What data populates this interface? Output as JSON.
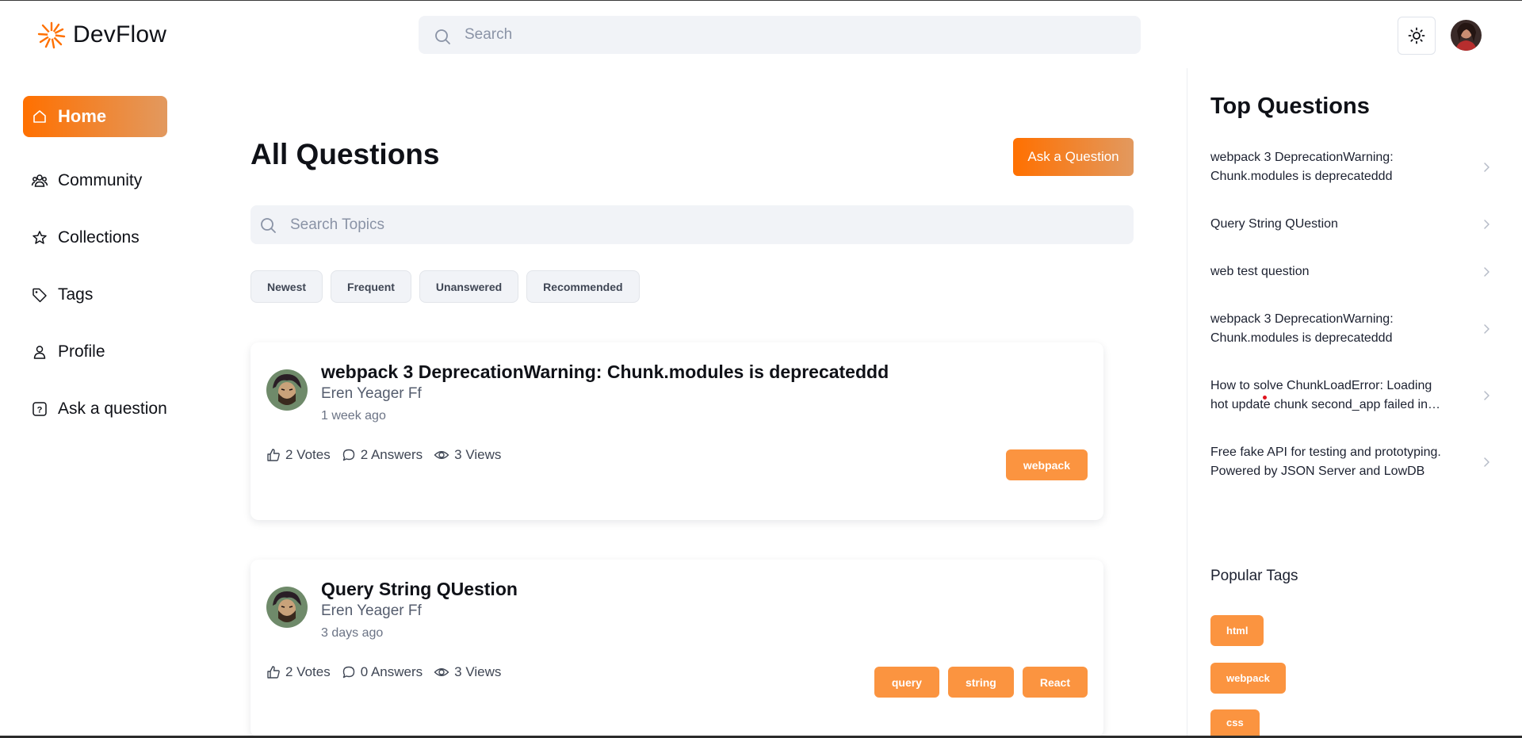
{
  "brand": {
    "name": "DevFlow"
  },
  "header": {
    "search_placeholder": "Search"
  },
  "sidebar": {
    "items": [
      {
        "label": "Home",
        "icon": "home-icon",
        "active": true
      },
      {
        "label": "Community",
        "icon": "users-icon",
        "active": false
      },
      {
        "label": "Collections",
        "icon": "star-icon",
        "active": false
      },
      {
        "label": "Tags",
        "icon": "tag-icon",
        "active": false
      },
      {
        "label": "Profile",
        "icon": "user-icon",
        "active": false
      },
      {
        "label": "Ask a question",
        "icon": "question-icon",
        "active": false
      }
    ]
  },
  "main": {
    "title": "All Questions",
    "ask_label": "Ask a Question",
    "search_placeholder": "Search Topics",
    "filters": [
      "Newest",
      "Frequent",
      "Unanswered",
      "Recommended"
    ],
    "questions": [
      {
        "title": "webpack 3 DeprecationWarning: Chunk.modules is deprecateddd",
        "author": "Eren Yeager Ff",
        "time": "1 week ago",
        "votes": "2 Votes",
        "answers": "2 Answers",
        "views": "3 Views",
        "tags": [
          "webpack"
        ]
      },
      {
        "title": "Query String QUestion",
        "author": "Eren Yeager Ff",
        "time": "3 days ago",
        "votes": "2 Votes",
        "answers": "0 Answers",
        "views": "3 Views",
        "tags": [
          "query",
          "string",
          "React"
        ]
      }
    ]
  },
  "right": {
    "top_title": "Top Questions",
    "top_questions": [
      "webpack 3 DeprecationWarning: Chunk.modules is deprecateddd",
      "Query String QUestion",
      "web test question",
      "webpack 3 DeprecationWarning: Chunk.modules is deprecateddd",
      "How to solve ChunkLoadError: Loading hot update chunk second_app failed in module federation",
      "Free fake API for testing and prototyping. Powered by JSON Server and LowDB"
    ],
    "popular_title": "Popular Tags",
    "popular_tags": [
      "html",
      "webpack",
      "css"
    ]
  },
  "colors": {
    "accent_start": "#ff7000",
    "accent_end": "#e2995f",
    "tag": "#fb9440"
  }
}
